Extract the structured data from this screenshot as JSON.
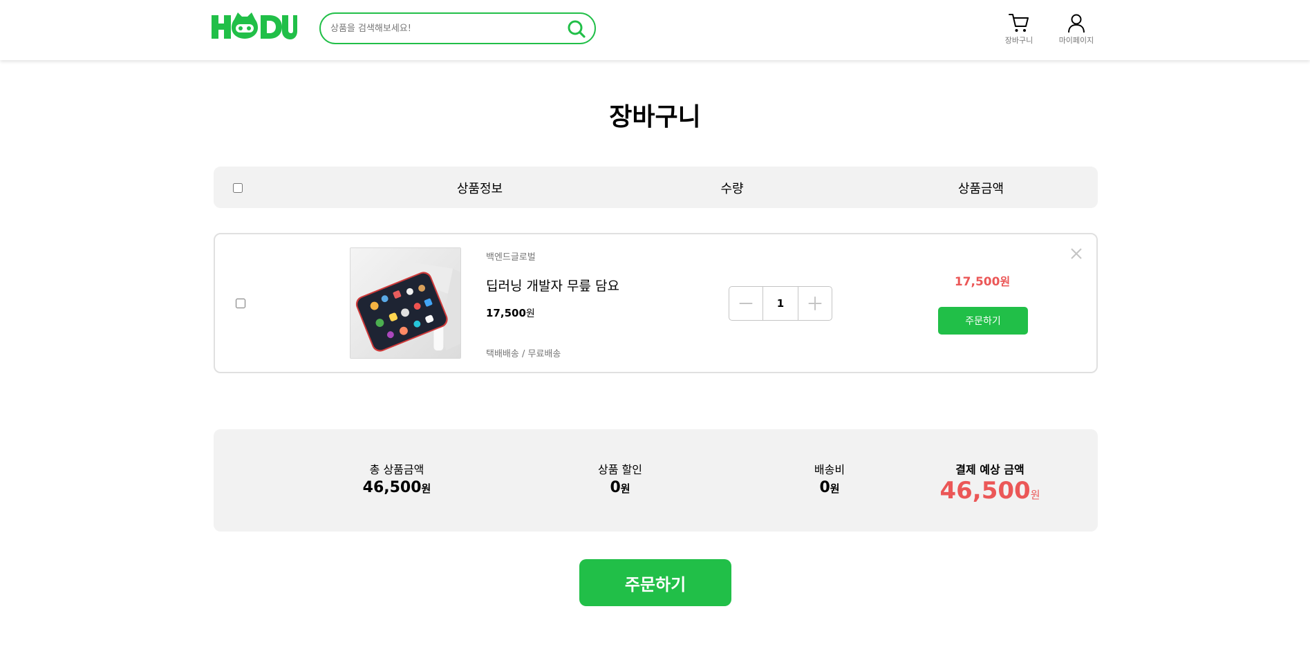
{
  "header": {
    "logo_text": "HODU",
    "search": {
      "placeholder": "상품을 검색해보세요!",
      "value": ""
    },
    "cart_label": "장바구니",
    "mypage_label": "마이페이지"
  },
  "page_title": "장바구니",
  "columns": {
    "product_info": "상품정보",
    "quantity": "수량",
    "price": "상품금액"
  },
  "cart_items": [
    {
      "seller": "백엔드글로벌",
      "name": "딥러닝 개발자 무릎 담요",
      "unit_price": "17,500",
      "currency": "원",
      "shipping": "택배배송 / 무료배송",
      "quantity": "1",
      "total_price": "17,500",
      "order_label": "주문하기"
    }
  ],
  "summary": {
    "total_label": "총 상품금액",
    "total_value": "46,500",
    "discount_label": "상품 할인",
    "discount_value": "0",
    "shipping_label": "배송비",
    "shipping_value": "0",
    "payment_label": "결제 예상 금액",
    "payment_value": "46,500",
    "currency": "원"
  },
  "order_button": "주문하기",
  "colors": {
    "brand_green": "#21bf48",
    "price_red": "#eb5757",
    "panel_gray": "#f2f2f2",
    "muted_text": "#767676"
  },
  "icons": [
    "search-icon",
    "cart-icon",
    "user-icon",
    "minus-icon",
    "plus-icon",
    "close-icon"
  ]
}
